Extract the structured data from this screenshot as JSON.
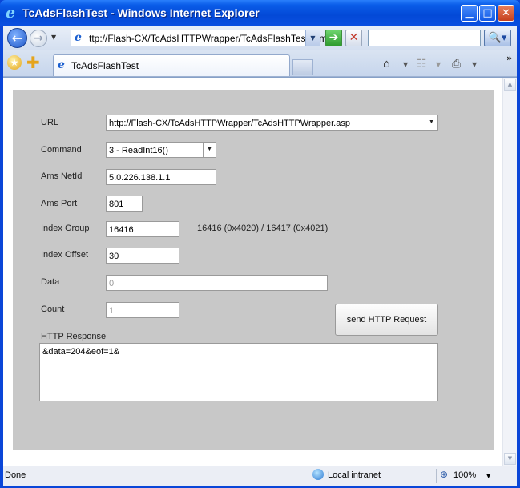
{
  "window": {
    "title": "TcAdsFlashTest - Windows Internet Explorer",
    "minimize_glyph": "▁",
    "maximize_glyph": "□",
    "close_glyph": "✕",
    "logo_glyph": "e"
  },
  "navbar": {
    "back_glyph": "←",
    "forward_glyph": "→",
    "address": "ttp://Flash-CX/TcAdsHTTPWrapper/TcAdsFlashTest.htm",
    "go_glyph": "➔",
    "stop_glyph": "✕",
    "search_placeholder": "",
    "search_glyph": "🔍▾"
  },
  "tabbar": {
    "tab_label": "TcAdsFlashTest",
    "home_glyph": "⌂",
    "rss_glyph": "☷",
    "print_glyph": "⎙",
    "more_glyph": "»"
  },
  "form": {
    "url_label": "URL",
    "url_value": "http://Flash-CX/TcAdsHTTPWrapper/TcAdsHTTPWrapper.asp",
    "command_label": "Command",
    "command_value": "3 - ReadInt16()",
    "ams_netid_label": "Ams NetId",
    "ams_netid_value": "5.0.226.138.1.1",
    "ams_port_label": "Ams Port",
    "ams_port_value": "801",
    "index_group_label": "Index Group",
    "index_group_value": "16416",
    "index_group_hint": "16416 (0x4020) / 16417 (0x4021)",
    "index_offset_label": "Index Offset",
    "index_offset_value": "30",
    "data_label": "Data",
    "data_value": "0",
    "count_label": "Count",
    "count_value": "1",
    "send_button": "send HTTP Request",
    "response_label": "HTTP Response",
    "response_value": "&data=204&eof=1&"
  },
  "statusbar": {
    "status": "Done",
    "zone": "Local intranet",
    "zoom": "100%"
  },
  "icons": {
    "back": "back-arrow-icon",
    "forward": "forward-arrow-icon",
    "go": "go-arrow-icon",
    "stop": "stop-icon",
    "search": "search-icon",
    "favorites": "favorites-star-icon",
    "add_favorites": "add-favorites-icon",
    "home": "home-icon",
    "rss": "rss-feed-icon",
    "print": "print-icon",
    "zone": "intranet-globe-icon",
    "zoom": "zoom-icon"
  }
}
